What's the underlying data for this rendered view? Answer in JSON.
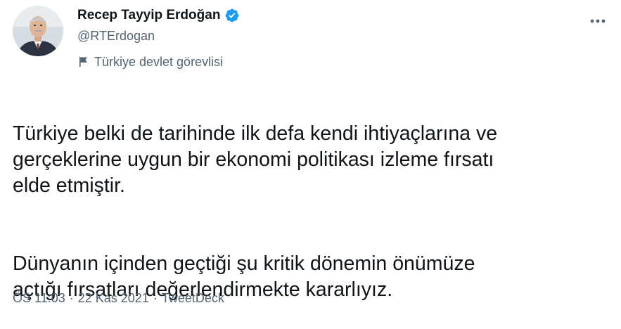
{
  "author": {
    "display_name": "Recep Tayyip Erdoğan",
    "handle": "@RTErdogan",
    "verified": true,
    "verified_icon": "verified-badge-icon",
    "label_icon": "flag-icon",
    "label": "Türkiye devlet görevlisi",
    "avatar_icon": "avatar"
  },
  "menu": {
    "more_icon": "more-horizontal-icon"
  },
  "tweet": {
    "paragraphs": [
      "Türkiye belki de tarihinde ilk defa kendi ihtiyaçlarına ve\ngerçeklerine uygun bir ekonomi politikası izleme fırsatı\nelde etmiştir.",
      "Dünyanın içinden geçtiği şu kritik dönemin önümüze\naçtığı fırsatları değerlendirmekte kararlıyız."
    ]
  },
  "meta": {
    "time": "ÖS 11:03",
    "separator": "·",
    "date": "22 Kas 2021",
    "source": "TweetDeck"
  },
  "colors": {
    "primary_text": "#0f1419",
    "secondary_text": "#536471",
    "verified_blue": "#1d9bf0"
  }
}
